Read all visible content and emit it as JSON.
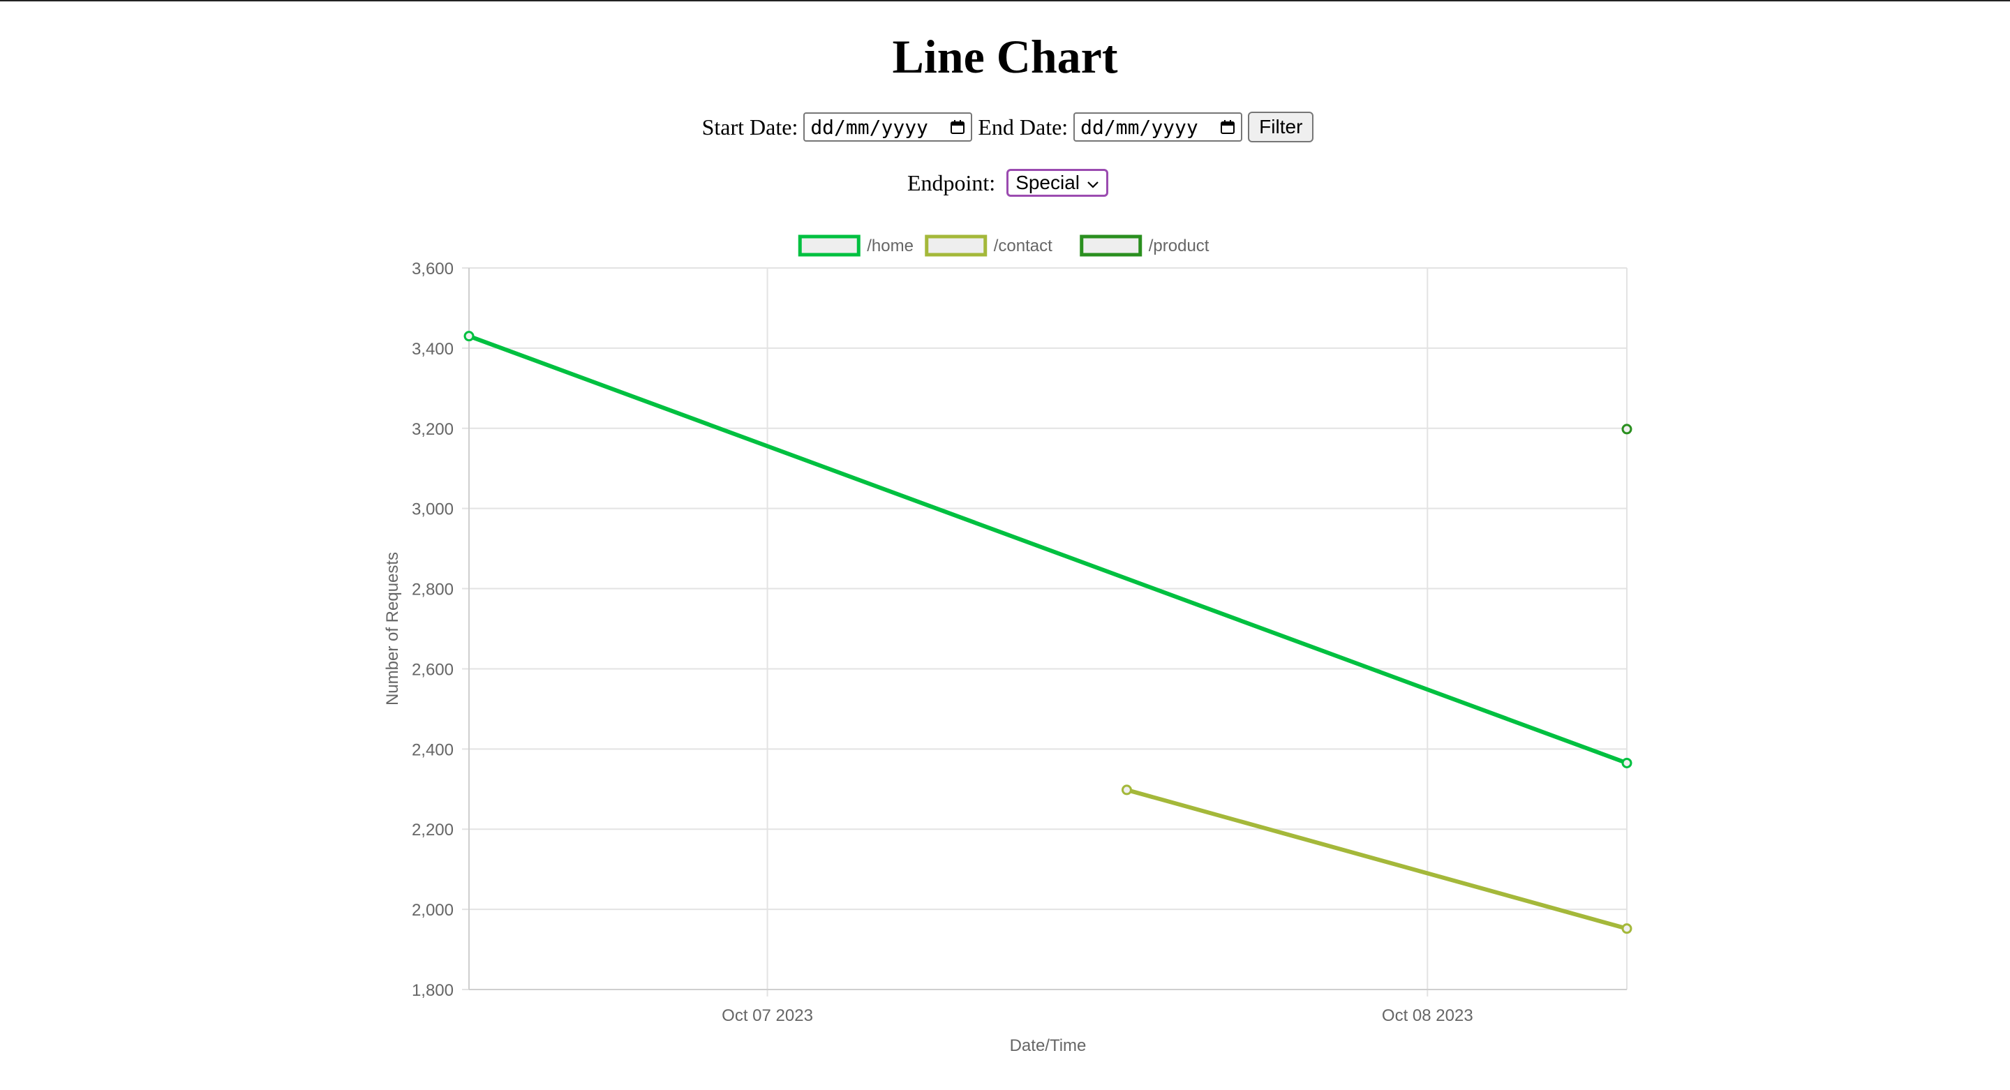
{
  "page": {
    "title": "Line Chart"
  },
  "filters": {
    "start_label": "Start Date:",
    "start_value": "dd/mm/yyyy",
    "end_label": "End Date:",
    "end_value": "dd/mm/yyyy",
    "filter_button": "Filter",
    "endpoint_label": "Endpoint:",
    "endpoint_selected": "Special"
  },
  "chart_data": {
    "type": "line",
    "xlabel": "Date/Time",
    "ylabel": "Number of Requests",
    "ylim": [
      1800,
      3600
    ],
    "yticks": [
      1800,
      2000,
      2200,
      2400,
      2600,
      2800,
      3000,
      3200,
      3400,
      3600
    ],
    "xlim": [
      "2023-10-06T13:09",
      "2023-10-08T07:15"
    ],
    "xticks": [
      {
        "label": "Oct 07 2023",
        "x": "2023-10-07T00:00"
      },
      {
        "label": "Oct 08 2023",
        "x": "2023-10-08T00:00"
      }
    ],
    "legend_position": "top",
    "grid": true,
    "series": [
      {
        "name": "/home",
        "color": "#00c040",
        "points": [
          {
            "x": "2023-10-06T13:09",
            "y": 3430
          },
          {
            "x": "2023-10-08T07:15",
            "y": 2365
          }
        ]
      },
      {
        "name": "/contact",
        "color": "#a4b83a",
        "points": [
          {
            "x": "2023-10-07T13:04",
            "y": 2298
          },
          {
            "x": "2023-10-08T07:15",
            "y": 1952
          }
        ]
      },
      {
        "name": "/product",
        "color": "#2a8f1f",
        "points": [
          {
            "x": "2023-10-08T07:15",
            "y": 3198
          }
        ]
      }
    ]
  }
}
